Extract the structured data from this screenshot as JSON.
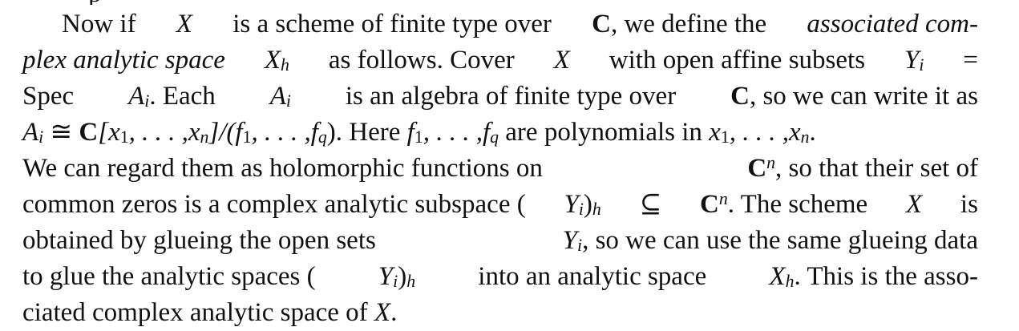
{
  "lines": [
    {
      "segments": [
        "Now if",
        "X",
        "is a scheme of finite type over",
        "C",
        ", we define the",
        "associated com-"
      ]
    },
    {
      "segments": [
        "plex analytic space",
        "X",
        "h",
        "as follows.  Cover",
        "X",
        "with open affine subsets",
        "Y",
        "i",
        "="
      ]
    },
    {
      "segments": [
        "Spec",
        "A",
        "i",
        ".  Each",
        "A",
        "i",
        "is an algebra of finite type over",
        "C",
        ", so we can write it as"
      ]
    },
    {
      "segments": [
        "A",
        "i",
        "≅",
        "C",
        "[x",
        "1",
        ", . . . ,x",
        "n",
        "]/(f",
        "1",
        ", . . . ,f",
        "q",
        ").  Here",
        "f",
        "1",
        ", . . . ,",
        "f",
        "q",
        "are polynomials in",
        "x",
        "1",
        ", . . . ,x",
        "n",
        "."
      ]
    },
    {
      "segments": [
        "We can regard them as holomorphic functions on",
        "C",
        "n",
        ", so that their set of"
      ]
    },
    {
      "segments": [
        "common zeros is a complex analytic subspace (",
        "Y",
        "i",
        ")",
        "h",
        "⊆",
        "C",
        "n",
        ".  The scheme",
        "X",
        "is"
      ]
    },
    {
      "segments": [
        "obtained by glueing the open sets",
        "Y",
        "i",
        ", so we can use the same glueing data"
      ]
    },
    {
      "segments": [
        "to glue the analytic spaces (",
        "Y",
        "i",
        ")",
        "h",
        "into an analytic space",
        "X",
        "h",
        ".  This is the asso-"
      ]
    },
    {
      "segments": [
        "ciated complex analytic space of",
        "X",
        "."
      ]
    }
  ]
}
